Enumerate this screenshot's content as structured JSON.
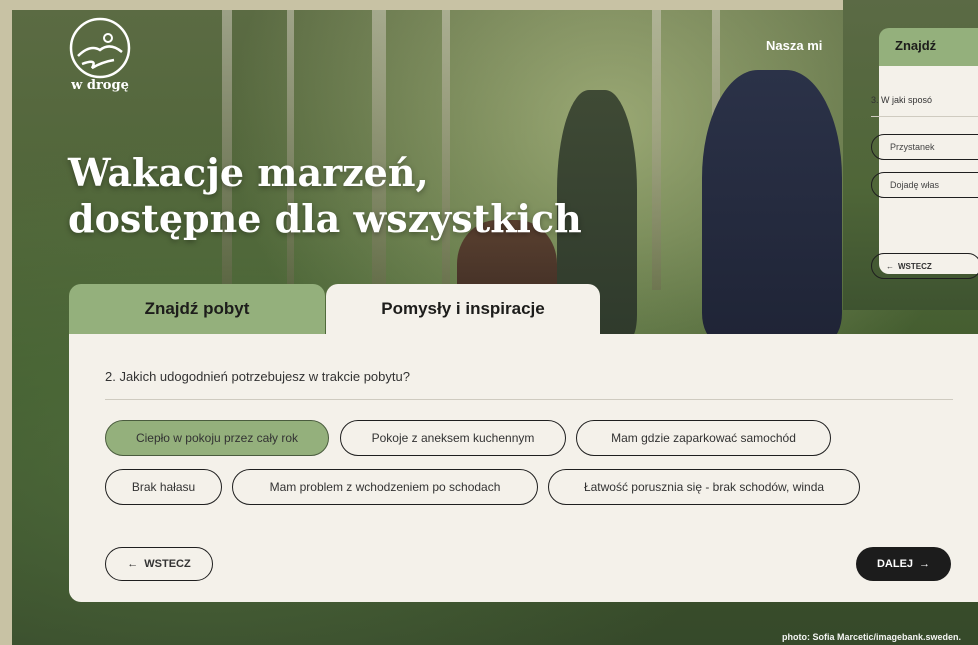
{
  "brand": {
    "logo_text": "w drogę"
  },
  "nav": {
    "link": "Nasza mi"
  },
  "hero": {
    "line1": "Wakacje marzeń,",
    "line2": "dostępne dla wszystkich"
  },
  "tabs": [
    {
      "label": "Znajdź pobyt",
      "active": false
    },
    {
      "label": "Pomysły i inspiracje",
      "active": true
    }
  ],
  "form": {
    "question": "2. Jakich udogodnień potrzebujesz w trakcie pobytu?",
    "options": [
      {
        "label": "Ciepło w pokoju przez cały rok",
        "selected": true
      },
      {
        "label": "Pokoje z aneksem kuchennym",
        "selected": false
      },
      {
        "label": "Mam gdzie zaparkować samochód",
        "selected": false
      },
      {
        "label": "Brak hałasu",
        "selected": false
      },
      {
        "label": "Mam problem z wchodzeniem po schodach",
        "selected": false
      },
      {
        "label": "Łatwość porusznia się - brak schodów, winda",
        "selected": false
      }
    ],
    "back_label": "WSTECZ",
    "next_label": "DALEJ"
  },
  "overlay": {
    "tab_label": "Znajdź",
    "question": "3. W jaki sposó",
    "options": [
      "Przystanek",
      "Dojadę włas"
    ],
    "back_label": "WSTECZ"
  },
  "credit": "photo: Sofia Marcetic/imagebank.sweden.",
  "colors": {
    "accent_green": "#94b07c",
    "panel": "#f4f1ea",
    "dark": "#1c1c1c"
  },
  "icons": {
    "back": "arrow-left-icon",
    "next": "arrow-right-icon",
    "logo": "mountain-road-logo-icon"
  }
}
